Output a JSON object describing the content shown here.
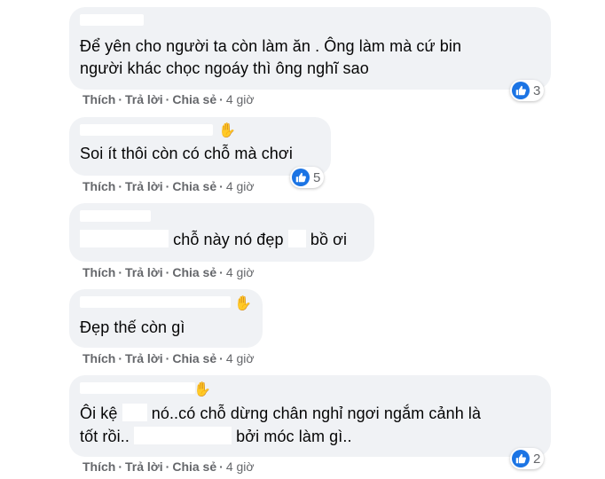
{
  "comments": [
    {
      "text_lines": [
        "Để yên cho người ta còn làm ăn . Ông làm mà cứ bin",
        "người khác chọc ngoáy thì ông nghĩ sao"
      ],
      "reactions": "3",
      "time": "4 giờ"
    },
    {
      "text_lines": [
        "Soi ít thôi còn có chỗ mà chơi"
      ],
      "reactions": "5",
      "time": "4 giờ"
    },
    {
      "text_before": "",
      "text_mid": "chỗ này nó đẹp",
      "text_after": "bồ ơi",
      "time": "4 giờ"
    },
    {
      "text_lines": [
        "Đẹp thế còn gì"
      ],
      "time": "4 giờ"
    },
    {
      "line1_a": "Ôi kệ",
      "line1_b": "nó..có chỗ dừng chân nghỉ ngơi ngắm cảnh là",
      "line2_a": "tốt rồi..",
      "line2_b": "bởi móc làm gì..",
      "reactions": "2",
      "time": "4 giờ"
    }
  ],
  "actions": {
    "like": "Thích",
    "reply": "Trả lời",
    "share": "Chia sẻ",
    "dot": "·"
  },
  "icons": {
    "like": "like-thumb-icon",
    "hand": "hand-wave-icon"
  },
  "colors": {
    "bubble": "#f0f2f5",
    "like_blue": "#1b74e4",
    "meta_gray": "#65676b"
  }
}
